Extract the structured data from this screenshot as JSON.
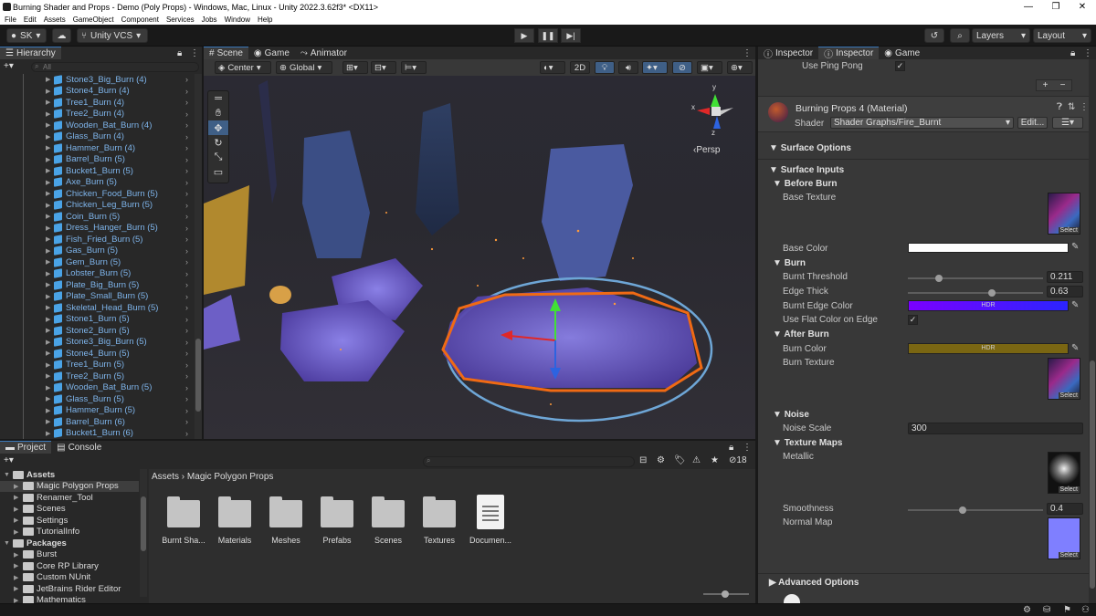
{
  "window": {
    "title": "Burning Shader and Props - Demo (Poly Props) - Windows, Mac, Linux - Unity 2022.3.62f3* <DX11>",
    "controls": [
      "—",
      "❐",
      "✕"
    ]
  },
  "menu": [
    "File",
    "Edit",
    "Assets",
    "GameObject",
    "Component",
    "Services",
    "Jobs",
    "Window",
    "Help"
  ],
  "toolbar": {
    "account": "SK",
    "vcs": "Unity VCS",
    "layers": "Layers",
    "layout": "Layout"
  },
  "hierarchy": {
    "title": "Hierarchy",
    "search_placeholder": "All",
    "items": [
      "Stone3_Big_Burn (4)",
      "Stone4_Burn (4)",
      "Tree1_Burn (4)",
      "Tree2_Burn (4)",
      "Wooden_Bat_Burn (4)",
      "Glass_Burn (4)",
      "Hammer_Burn (4)",
      "Barrel_Burn (5)",
      "Bucket1_Burn (5)",
      "Axe_Burn (5)",
      "Chicken_Food_Burn (5)",
      "Chicken_Leg_Burn (5)",
      "Coin_Burn (5)",
      "Dress_Hanger_Burn (5)",
      "Fish_Fried_Burn (5)",
      "Gas_Burn (5)",
      "Gem_Burn (5)",
      "Lobster_Burn (5)",
      "Plate_Big_Burn (5)",
      "Plate_Small_Burn (5)",
      "Skeletal_Head_Burn (5)",
      "Stone1_Burn (5)",
      "Stone2_Burn (5)",
      "Stone3_Big_Burn (5)",
      "Stone4_Burn (5)",
      "Tree1_Burn (5)",
      "Tree2_Burn (5)",
      "Wooden_Bat_Burn (5)",
      "Glass_Burn (5)",
      "Hammer_Burn (5)",
      "Barrel_Burn (6)",
      "Bucket1_Burn (6)"
    ]
  },
  "scene": {
    "tabs": [
      "Scene",
      "Game",
      "Animator"
    ],
    "pivot": "Center",
    "space": "Global",
    "mode2d": "2D",
    "persp": "Persp",
    "gizmo_axes": {
      "y": "y",
      "x": "x",
      "z": "z"
    }
  },
  "inspector": {
    "tabs": [
      "Inspector",
      "Inspector",
      "Game"
    ],
    "ping_pong_label": "Use Ping Pong",
    "material_name": "Burning Props 4 (Material)",
    "shader_label": "Shader",
    "shader_value": "Shader Graphs/Fire_Burnt",
    "edit_label": "Edit...",
    "surface_options": "Surface Options",
    "surface_inputs": "Surface Inputs",
    "before_burn": "Before Burn",
    "base_texture": "Base Texture",
    "base_color": "Base Color",
    "burn": "Burn",
    "burnt_threshold_label": "Burnt Threshold",
    "burnt_threshold": "0.211",
    "edge_thick_label": "Edge Thick",
    "edge_thick": "0.63",
    "burnt_edge_color": "Burnt Edge Color",
    "flat_color_label": "Use Flat Color on Edge",
    "after_burn": "After Burn",
    "burn_color": "Burn Color",
    "burn_texture": "Burn Texture",
    "noise": "Noise",
    "noise_scale_label": "Noise Scale",
    "noise_scale": "300",
    "texture_maps": "Texture Maps",
    "metallic": "Metallic",
    "smoothness_label": "Smoothness",
    "smoothness": "0.4",
    "normal_map": "Normal Map",
    "advanced": "Advanced Options",
    "hdr": "HDR",
    "select": "Select",
    "threshold_fraction": 0.211,
    "edge_fraction": 0.63,
    "smooth_fraction": 0.4
  },
  "project": {
    "tabs": [
      "Project",
      "Console"
    ],
    "badge": "18",
    "breadcrumb": [
      "Assets",
      "Magic Polygon Props"
    ],
    "tree": [
      {
        "label": "Assets",
        "level": 0,
        "bold": true
      },
      {
        "label": "Magic Polygon Props",
        "level": 1,
        "selected": true
      },
      {
        "label": "Renamer_Tool",
        "level": 1
      },
      {
        "label": "Scenes",
        "level": 1
      },
      {
        "label": "Settings",
        "level": 1
      },
      {
        "label": "TutorialInfo",
        "level": 1
      },
      {
        "label": "Packages",
        "level": 0,
        "bold": true
      },
      {
        "label": "Burst",
        "level": 1
      },
      {
        "label": "Core RP Library",
        "level": 1
      },
      {
        "label": "Custom NUnit",
        "level": 1
      },
      {
        "label": "JetBrains Rider Editor",
        "level": 1
      },
      {
        "label": "Mathematics",
        "level": 1
      }
    ],
    "items": [
      "Burnt Sha...",
      "Materials",
      "Meshes",
      "Prefabs",
      "Scenes",
      "Textures",
      "Documen..."
    ]
  },
  "colors": {
    "accent": "#3a79bb",
    "hier_text": "#7eb4ea",
    "edge_color_start": "#7a00ff",
    "edge_color_end": "#2b24ff",
    "burn_color": "#7a6612",
    "normal_map": "#7f7fff"
  }
}
